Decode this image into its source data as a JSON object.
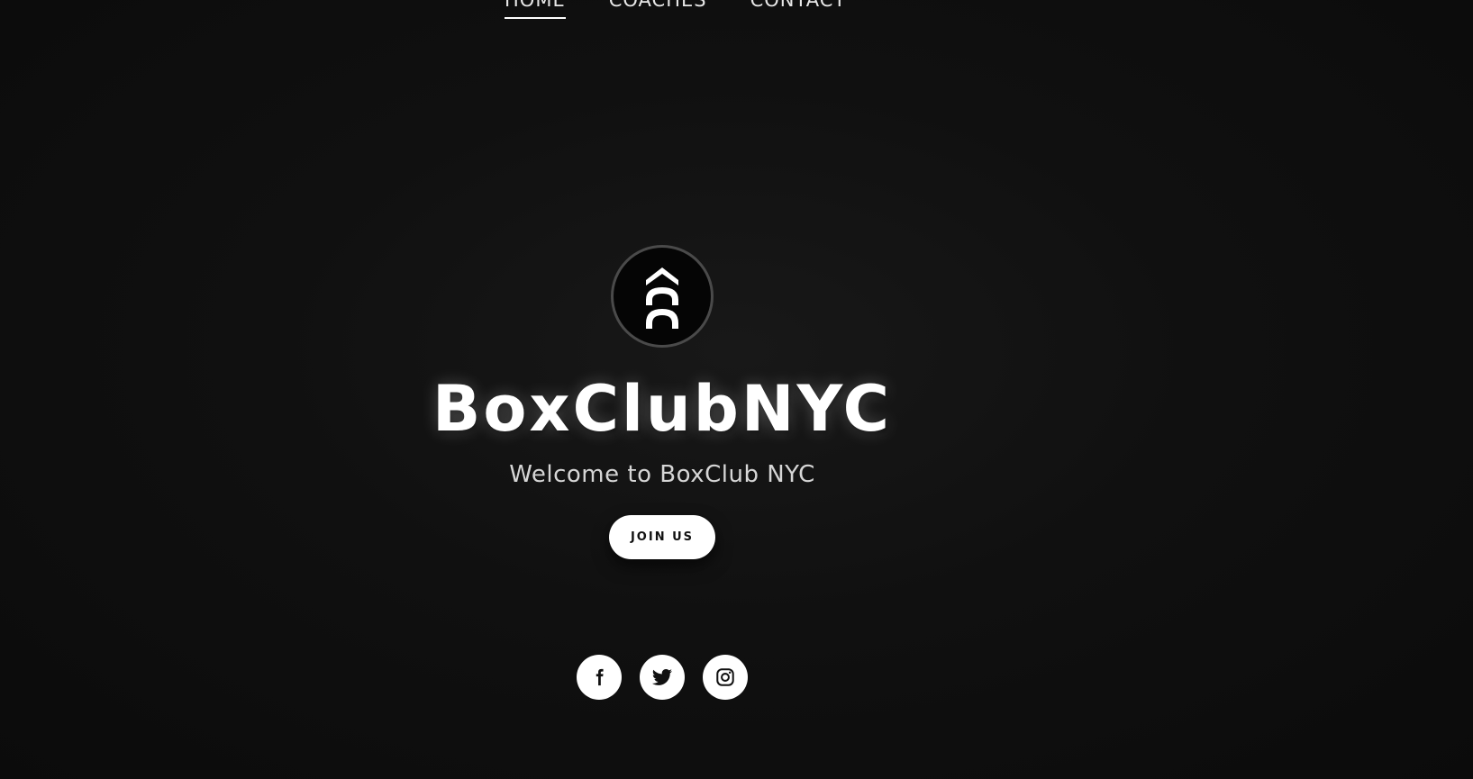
{
  "nav": {
    "items": [
      {
        "label": "HOME",
        "active": true
      },
      {
        "label": "COACHES",
        "active": false
      },
      {
        "label": "CONTACT",
        "active": false
      }
    ]
  },
  "hero": {
    "logo_icon": "boxclub-chevron-arch-logo",
    "title": "BoxClubNYC",
    "tagline": "Welcome to BoxClub NYC",
    "cta_label": "JOIN US"
  },
  "socials": [
    {
      "icon": "facebook-icon"
    },
    {
      "icon": "twitter-icon"
    },
    {
      "icon": "instagram-icon"
    }
  ],
  "colors": {
    "background": "#0e0e0e",
    "text": "#ffffff",
    "button_bg": "#ffffff",
    "button_text": "#111111",
    "logo_ring": "#4a4a4a"
  }
}
